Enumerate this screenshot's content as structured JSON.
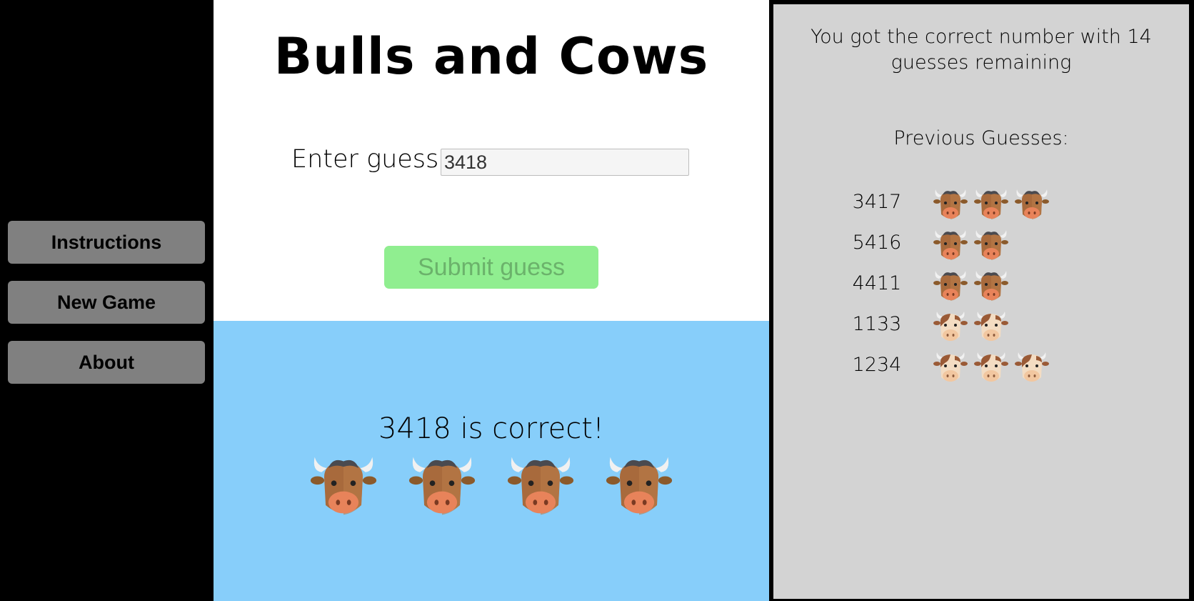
{
  "sidebar": {
    "buttons": [
      "Instructions",
      "New Game",
      "About"
    ]
  },
  "game": {
    "title": "Bulls and Cows",
    "guess_label": "Enter guess:",
    "guess_value": "3418",
    "submit_label": "Submit guess",
    "result_text": "3418 is correct!",
    "result_icons": [
      "bull-icon",
      "bull-icon",
      "bull-icon",
      "bull-icon"
    ]
  },
  "history": {
    "status": "You got the correct number with 14 guesses remaining",
    "title": "Previous Guesses:",
    "guesses": [
      {
        "number": "3417",
        "bulls": 3,
        "cows": 0
      },
      {
        "number": "5416",
        "bulls": 2,
        "cows": 0
      },
      {
        "number": "4411",
        "bulls": 2,
        "cows": 0
      },
      {
        "number": "1133",
        "bulls": 0,
        "cows": 2
      },
      {
        "number": "1234",
        "bulls": 0,
        "cows": 3
      }
    ]
  },
  "colors": {
    "sidebar_bg": "#000000",
    "button_bg": "#808080",
    "submit_bg": "#90ee90",
    "result_bg": "#87cefa",
    "history_bg": "#d3d3d3"
  }
}
